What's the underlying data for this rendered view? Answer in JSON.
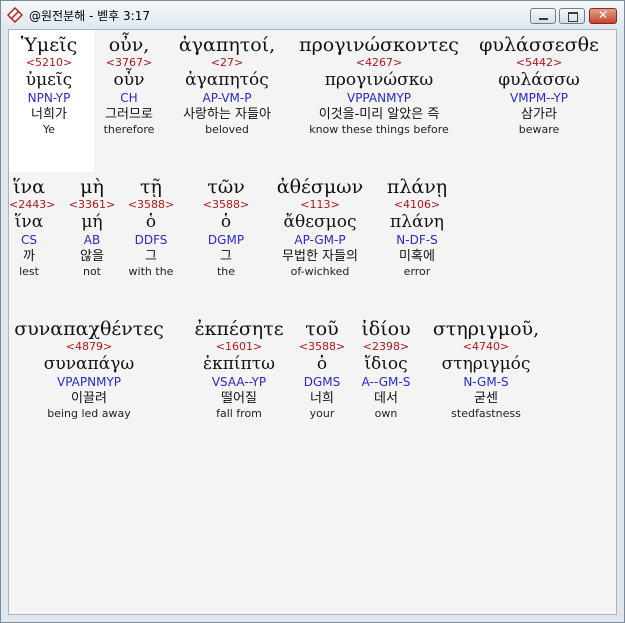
{
  "window": {
    "title": "@원전분해 - 벧후 3:17"
  },
  "rows": [
    {
      "words": [
        {
          "greek": "Ὑμεῖς",
          "strong": "<5210>",
          "lemma": "ὑμεῖς",
          "parse": "NPN-YP",
          "korean": "너희가",
          "english": "Ye"
        },
        {
          "greek": "οὖν,",
          "strong": "<3767>",
          "lemma": "οὖν",
          "parse": "CH",
          "korean": "그러므로",
          "english": "therefore"
        },
        {
          "greek": "ἀγαπητοί,",
          "strong": "<27>",
          "lemma": "ἀγαπητός",
          "parse": "AP-VM-P",
          "korean": "사랑하는 자들아",
          "english": "beloved"
        },
        {
          "greek": "προγινώσκοντες",
          "strong": "<4267>",
          "lemma": "προγινώσκω",
          "parse": "VPPANMYP",
          "korean": "이것을-미리 알았은 즉",
          "english": "know these things before"
        },
        {
          "greek": "φυλάσσεσθε",
          "strong": "<5442>",
          "lemma": "φυλάσσω",
          "parse": "VMPM--YP",
          "korean": "삼가라",
          "english": "beware"
        }
      ]
    },
    {
      "words": [
        {
          "greek": "ἵνα",
          "strong": "<2443>",
          "lemma": "ἵνα",
          "parse": "CS",
          "korean": "까",
          "english": "lest"
        },
        {
          "greek": "μὴ",
          "strong": "<3361>",
          "lemma": "μή",
          "parse": "AB",
          "korean": "않을",
          "english": "not"
        },
        {
          "greek": "τῇ",
          "strong": "<3588>",
          "lemma": "ὁ",
          "parse": "DDFS",
          "korean": "그",
          "english": "with the"
        },
        {
          "greek": "τῶν",
          "strong": "<3588>",
          "lemma": "ὁ",
          "parse": "DGMP",
          "korean": "그",
          "english": "the"
        },
        {
          "greek": "ἀθέσμων",
          "strong": "<113>",
          "lemma": "ἄθεσμος",
          "parse": "AP-GM-P",
          "korean": "무법한 자들의",
          "english": "of-wichked"
        },
        {
          "greek": "πλάνῃ",
          "strong": "<4106>",
          "lemma": "πλάνη",
          "parse": "N-DF-S",
          "korean": "미혹에",
          "english": "error"
        }
      ]
    },
    {
      "words": [
        {
          "greek": "συναπαχθέντες",
          "strong": "<4879>",
          "lemma": "συναπάγω",
          "parse": "VPAPNMYP",
          "korean": "이끌려",
          "english": "being led away"
        },
        {
          "greek": "ἐκπέσητε",
          "strong": "<1601>",
          "lemma": "ἐκπίπτω",
          "parse": "VSAA--YP",
          "korean": "떨어질",
          "english": "fall from"
        },
        {
          "greek": "τοῦ",
          "strong": "<3588>",
          "lemma": "ὁ",
          "parse": "DGMS",
          "korean": "너희",
          "english": "your"
        },
        {
          "greek": "ἰδίου",
          "strong": "<2398>",
          "lemma": "ἴδιος",
          "parse": "A--GM-S",
          "korean": "데서",
          "english": "own"
        },
        {
          "greek": "στηριγμοῦ,",
          "strong": "<4740>",
          "lemma": "στηριγμός",
          "parse": "N-GM-S",
          "korean": "굳센",
          "english": "stedfastness"
        }
      ]
    }
  ]
}
